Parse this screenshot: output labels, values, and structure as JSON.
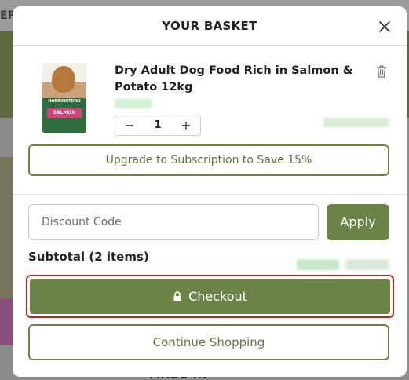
{
  "background": {
    "topbar_text": "ER",
    "bottom_text": "MADE IN"
  },
  "modal": {
    "title": "YOUR BASKET",
    "close_icon": "close-icon"
  },
  "item": {
    "name": "Dry Adult Dog Food Rich in Salmon & Potato 12kg",
    "quantity": "1",
    "decrement_label": "−",
    "increment_label": "+",
    "thumb_brand": "HARRINGTONS",
    "thumb_tag": "SALMON",
    "delete_icon": "trash-icon"
  },
  "upgrade_button": "Upgrade to Subscription to Save 15%",
  "discount": {
    "placeholder": "Discount Code",
    "apply_label": "Apply"
  },
  "subtotal_label": "Subtotal (2 items)",
  "checkout_label": "Checkout",
  "continue_label": "Continue Shopping",
  "colors": {
    "brand_green": "#6b8347",
    "highlight_red": "#d21a1a"
  }
}
